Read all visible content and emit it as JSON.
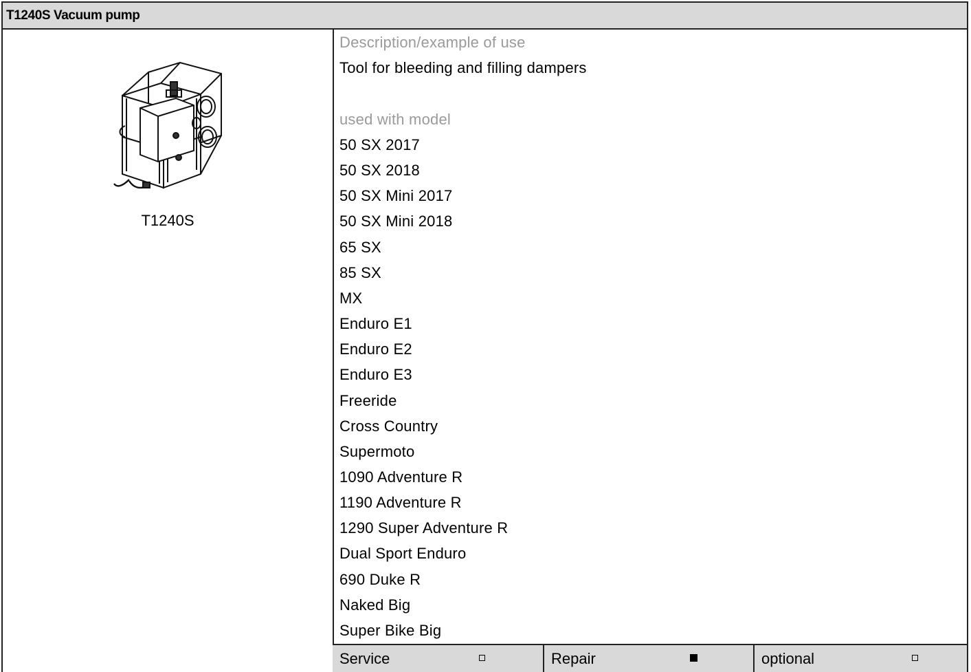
{
  "header": {
    "title": "T1240S Vacuum pump"
  },
  "tool": {
    "caption": "T1240S",
    "image_icon": "vacuum-pump-drawing"
  },
  "description": {
    "label": "Description/example of use",
    "text": "Tool for bleeding and filling dampers"
  },
  "models": {
    "label": "used with model",
    "items": [
      "50 SX 2017",
      "50 SX 2018",
      "50 SX Mini 2017",
      "50 SX Mini 2018",
      "65 SX",
      "85 SX",
      "MX",
      "Enduro E1",
      "Enduro E2",
      "Enduro E3",
      "Freeride",
      "Cross Country",
      "Supermoto",
      "1090 Adventure R",
      "1190 Adventure R",
      "1290 Super Adventure R",
      "Dual Sport Enduro",
      "690 Duke R",
      "Naked Big",
      "Super Bike Big"
    ]
  },
  "footer": {
    "cells": [
      {
        "label": "Service",
        "checked": false
      },
      {
        "label": "Repair",
        "checked": true
      },
      {
        "label": "optional",
        "checked": false
      }
    ]
  },
  "colors": {
    "header_bg": "#d9d9d9",
    "muted_text": "#9a9a9a",
    "border": "#222222"
  }
}
